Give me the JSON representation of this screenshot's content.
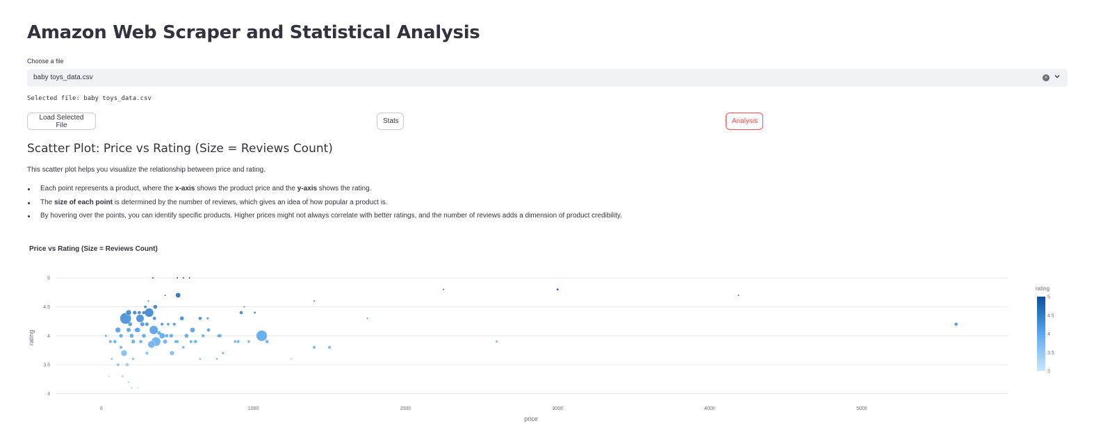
{
  "page": {
    "title": "Amazon Web Scraper and Statistical Analysis",
    "file_select": {
      "label": "Choose a file",
      "value": "baby toys_data.csv"
    },
    "selected_text": "Selected file: baby toys_data.csv",
    "buttons": {
      "load": "Load Selected File",
      "stats": "Stats",
      "analysis": "Analysis"
    },
    "section_heading": "Scatter Plot: Price vs Rating (Size = Reviews Count)",
    "intro": "This scatter plot helps you visualize the relationship between price and rating.",
    "bullets": [
      {
        "pre": "Each point represents a product, where the ",
        "b1": "x-axis",
        "mid": " shows the product price and the ",
        "b2": "y-axis",
        "post": " shows the rating."
      },
      {
        "pre": "The ",
        "b1": "size of each point",
        "mid": " is determined by the number of reviews, which gives an idea of how popular a product is.",
        "b2": "",
        "post": ""
      },
      {
        "pre": "By hovering over the points, you can identify specific products. Higher prices might not always correlate with better ratings, and the number of reviews adds a dimension of product credibility.",
        "b1": "",
        "mid": "",
        "b2": "",
        "post": ""
      }
    ],
    "accent_color": "#ff4b4b"
  },
  "chart_data": {
    "type": "scatter",
    "title": "Price vs Rating (Size = Reviews Count)",
    "xlabel": "price",
    "ylabel": "rating",
    "xlim": [
      -300,
      5960
    ],
    "ylim": [
      2.9,
      5
    ],
    "xticks": [
      0,
      1000,
      2000,
      3000,
      4000,
      5000
    ],
    "yticks": [
      3,
      3.5,
      4,
      4.5,
      5
    ],
    "grid": true,
    "colorbar": {
      "title": "rating",
      "range": [
        3,
        5
      ],
      "ticks": [
        3,
        3.5,
        4,
        4.5,
        5
      ],
      "low_color": "#cce8fb",
      "high_color": "#0b4fa0"
    },
    "points": [
      {
        "x": 160,
        "y": 4.3,
        "reviews": 60
      },
      {
        "x": 315,
        "y": 4.4,
        "reviews": 38
      },
      {
        "x": 1055,
        "y": 4.0,
        "reviews": 56
      },
      {
        "x": 505,
        "y": 4.7,
        "reviews": 12
      },
      {
        "x": 255,
        "y": 4.3,
        "reviews": 30
      },
      {
        "x": 345,
        "y": 4.1,
        "reviews": 36
      },
      {
        "x": 360,
        "y": 3.9,
        "reviews": 40
      },
      {
        "x": 330,
        "y": 3.85,
        "reviews": 24
      },
      {
        "x": 150,
        "y": 3.7,
        "reviews": 18
      },
      {
        "x": 110,
        "y": 4.1,
        "reviews": 14
      },
      {
        "x": 400,
        "y": 4.0,
        "reviews": 16
      },
      {
        "x": 465,
        "y": 3.7,
        "reviews": 10
      },
      {
        "x": 600,
        "y": 4.1,
        "reviews": 12
      },
      {
        "x": 180,
        "y": 4.4,
        "reviews": 14
      },
      {
        "x": 240,
        "y": 4.1,
        "reviews": 12
      },
      {
        "x": 530,
        "y": 4.3,
        "reviews": 9
      },
      {
        "x": 355,
        "y": 4.5,
        "reviews": 7
      },
      {
        "x": 705,
        "y": 4.1,
        "reviews": 5
      },
      {
        "x": 920,
        "y": 4.4,
        "reviews": 5
      },
      {
        "x": 270,
        "y": 4.2,
        "reviews": 8
      },
      {
        "x": 200,
        "y": 4.0,
        "reviews": 9
      },
      {
        "x": 420,
        "y": 3.9,
        "reviews": 8
      },
      {
        "x": 560,
        "y": 4.0,
        "reviews": 7
      },
      {
        "x": 650,
        "y": 4.3,
        "reviews": 5
      },
      {
        "x": 620,
        "y": 3.9,
        "reviews": 5
      },
      {
        "x": 780,
        "y": 4.0,
        "reviews": 5
      },
      {
        "x": 900,
        "y": 3.9,
        "reviews": 4
      },
      {
        "x": 1090,
        "y": 3.9,
        "reviews": 5
      },
      {
        "x": 1400,
        "y": 3.8,
        "reviews": 4
      },
      {
        "x": 1500,
        "y": 3.8,
        "reviews": 4
      },
      {
        "x": 2600,
        "y": 3.9,
        "reviews": 2
      },
      {
        "x": 5620,
        "y": 4.2,
        "reviews": 5
      },
      {
        "x": 3000,
        "y": 4.8,
        "reviews": 2
      },
      {
        "x": 2250,
        "y": 4.8,
        "reviews": 1
      },
      {
        "x": 4190,
        "y": 4.7,
        "reviews": 1
      },
      {
        "x": 1400,
        "y": 4.6,
        "reviews": 1
      },
      {
        "x": 1750,
        "y": 4.3,
        "reviews": 1
      },
      {
        "x": 1250,
        "y": 3.6,
        "reviews": 1
      },
      {
        "x": 90,
        "y": 3.9,
        "reviews": 5
      },
      {
        "x": 130,
        "y": 3.8,
        "reviews": 4
      },
      {
        "x": 170,
        "y": 3.5,
        "reviews": 5
      },
      {
        "x": 110,
        "y": 3.5,
        "reviews": 4
      },
      {
        "x": 180,
        "y": 3.2,
        "reviews": 2
      },
      {
        "x": 140,
        "y": 3.3,
        "reviews": 2
      },
      {
        "x": 200,
        "y": 3.1,
        "reviews": 2
      },
      {
        "x": 240,
        "y": 3.1,
        "reviews": 1
      },
      {
        "x": 50,
        "y": 3.3,
        "reviews": 1
      },
      {
        "x": 210,
        "y": 3.6,
        "reviews": 3
      },
      {
        "x": 300,
        "y": 3.7,
        "reviews": 4
      },
      {
        "x": 60,
        "y": 3.9,
        "reviews": 4
      },
      {
        "x": 400,
        "y": 4.2,
        "reviews": 4
      },
      {
        "x": 440,
        "y": 4.2,
        "reviews": 3
      },
      {
        "x": 480,
        "y": 4.2,
        "reviews": 4
      },
      {
        "x": 220,
        "y": 4.4,
        "reviews": 6
      },
      {
        "x": 250,
        "y": 4.4,
        "reviews": 5
      },
      {
        "x": 280,
        "y": 4.4,
        "reviews": 5
      },
      {
        "x": 190,
        "y": 4.2,
        "reviews": 7
      },
      {
        "x": 300,
        "y": 4.2,
        "reviews": 6
      },
      {
        "x": 350,
        "y": 4.3,
        "reviews": 5
      },
      {
        "x": 590,
        "y": 3.9,
        "reviews": 4
      },
      {
        "x": 760,
        "y": 3.6,
        "reviews": 2
      },
      {
        "x": 800,
        "y": 3.7,
        "reviews": 3
      },
      {
        "x": 650,
        "y": 3.6,
        "reviews": 2
      },
      {
        "x": 970,
        "y": 3.9,
        "reviews": 3
      },
      {
        "x": 1010,
        "y": 4.4,
        "reviews": 2
      },
      {
        "x": 700,
        "y": 4.3,
        "reviews": 2
      },
      {
        "x": 770,
        "y": 4.0,
        "reviews": 3
      },
      {
        "x": 880,
        "y": 3.9,
        "reviews": 3
      },
      {
        "x": 500,
        "y": 3.9,
        "reviews": 4
      },
      {
        "x": 540,
        "y": 3.8,
        "reviews": 3
      },
      {
        "x": 130,
        "y": 4.0,
        "reviews": 6
      },
      {
        "x": 210,
        "y": 3.9,
        "reviews": 7
      },
      {
        "x": 260,
        "y": 3.9,
        "reviews": 5
      },
      {
        "x": 280,
        "y": 4.0,
        "reviews": 7
      },
      {
        "x": 380,
        "y": 4.05,
        "reviews": 6
      },
      {
        "x": 430,
        "y": 4.0,
        "reviews": 5
      },
      {
        "x": 490,
        "y": 3.9,
        "reviews": 4
      },
      {
        "x": 290,
        "y": 4.5,
        "reviews": 3
      },
      {
        "x": 310,
        "y": 4.6,
        "reviews": 1
      },
      {
        "x": 420,
        "y": 4.7,
        "reviews": 1
      },
      {
        "x": 500,
        "y": 5.0,
        "reviews": 1
      },
      {
        "x": 540,
        "y": 5.0,
        "reviews": 1
      },
      {
        "x": 580,
        "y": 5.0,
        "reviews": 1
      },
      {
        "x": 340,
        "y": 5.0,
        "reviews": 1
      },
      {
        "x": 940,
        "y": 4.5,
        "reviews": 1
      },
      {
        "x": 30,
        "y": 4.0,
        "reviews": 2
      },
      {
        "x": 70,
        "y": 3.6,
        "reviews": 2
      },
      {
        "x": 180,
        "y": 4.1,
        "reviews": 8
      },
      {
        "x": 230,
        "y": 4.1,
        "reviews": 5
      },
      {
        "x": 460,
        "y": 4.0,
        "reviews": 6
      },
      {
        "x": 670,
        "y": 4.0,
        "reviews": 4
      }
    ]
  }
}
